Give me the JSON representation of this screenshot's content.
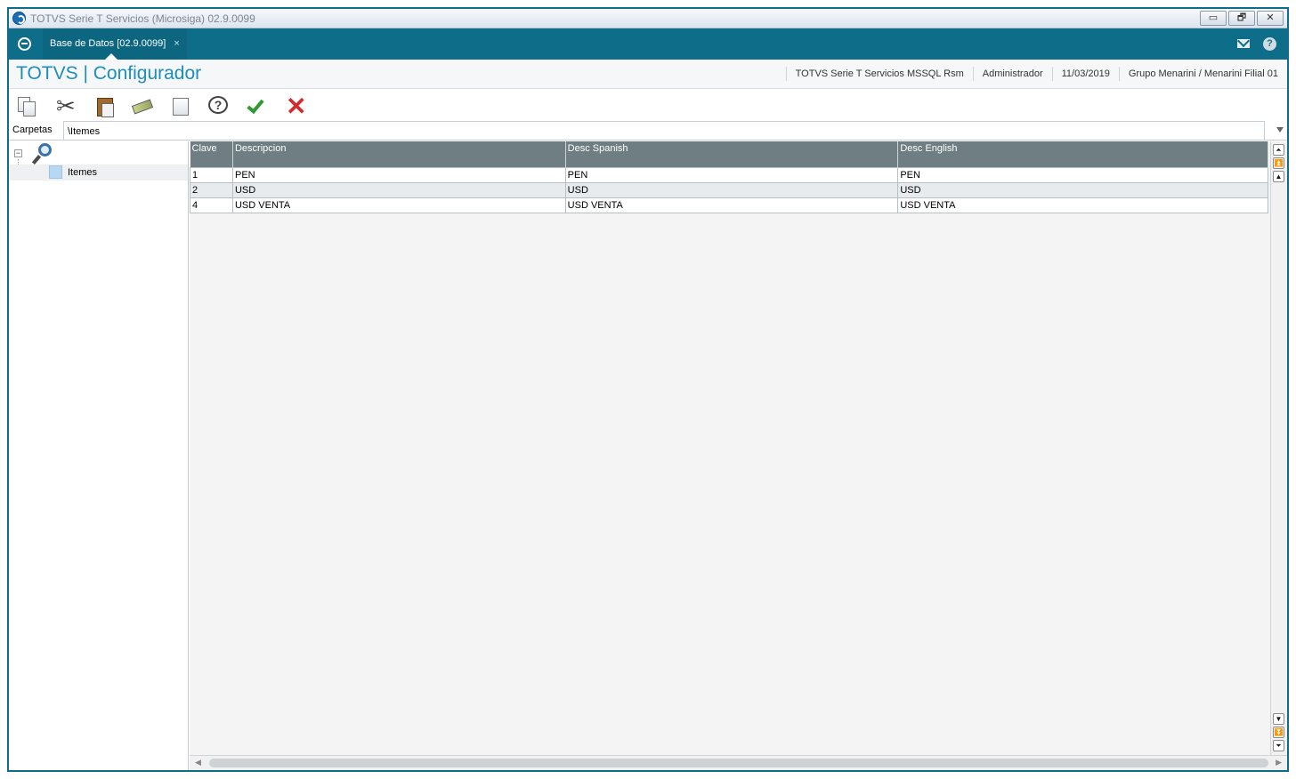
{
  "window": {
    "title": "TOTVS Serie T Servicios (Microsiga) 02.9.0099",
    "controls": [
      "▭",
      "🗗",
      "✕"
    ]
  },
  "tabbar": {
    "tab_label": "Base de Datos [02.9.0099]",
    "tab_close": "×",
    "help_glyph": "?"
  },
  "header": {
    "brand": "TOTVS | Configurador",
    "info": {
      "environment": "TOTVS Serie T Servicios MSSQL Rsm",
      "user": "Administrador",
      "date": "11/03/2019",
      "company": "Grupo Menarini / Menarini Filial 01"
    }
  },
  "toolbar": {
    "icons": [
      "copy-icon",
      "cut-icon",
      "paste-icon",
      "eraser-icon",
      "print-icon",
      "help-icon",
      "confirm-icon",
      "cancel-icon"
    ]
  },
  "folderbar": {
    "label": "Carpetas",
    "path": "\\Itemes"
  },
  "tree": {
    "node_label": "Itemes"
  },
  "grid": {
    "columns": [
      "Clave",
      "Descripcion",
      "Desc Spanish",
      "Desc English"
    ],
    "rows": [
      [
        "1",
        "PEN",
        "PEN",
        "PEN"
      ],
      [
        "2",
        "USD",
        "USD",
        "USD"
      ],
      [
        "4",
        "USD VENTA",
        "USD VENTA",
        "USD VENTA"
      ]
    ]
  },
  "colors": {
    "accent": "#0e6e8a",
    "brand_text": "#1f8dbb",
    "grid_header": "#6e7e83"
  }
}
